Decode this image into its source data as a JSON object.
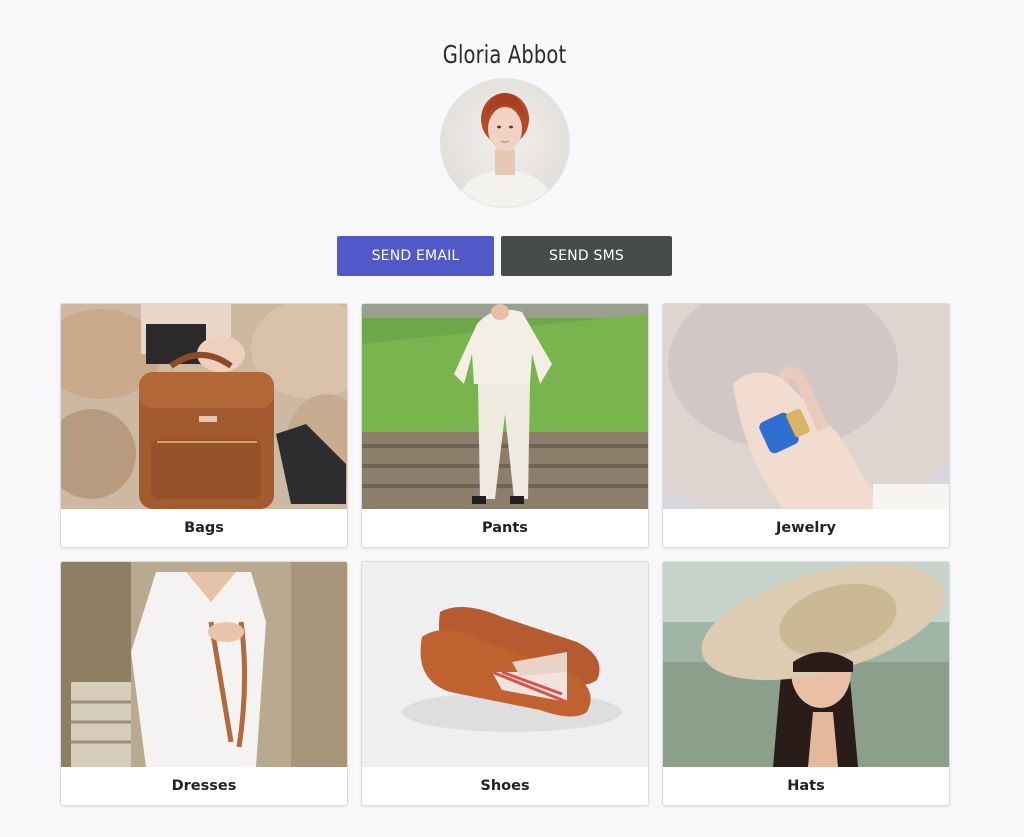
{
  "profile": {
    "name": "Gloria Abbot"
  },
  "actions": {
    "email_label": "SEND EMAIL",
    "sms_label": "SEND SMS"
  },
  "categories": [
    {
      "label": "Bags"
    },
    {
      "label": "Pants"
    },
    {
      "label": "Jewelry"
    },
    {
      "label": "Dresses"
    },
    {
      "label": "Shoes"
    },
    {
      "label": "Hats"
    }
  ],
  "colors": {
    "email_button": "#5259c8",
    "sms_button": "#464c4a",
    "background": "#f8f8fb"
  }
}
